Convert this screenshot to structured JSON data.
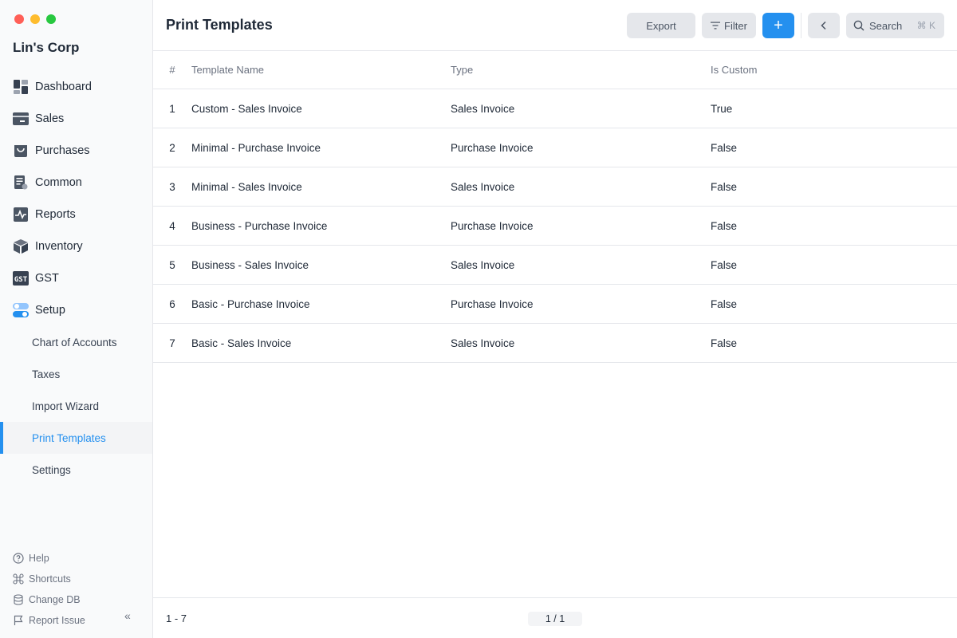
{
  "window": {
    "controls": [
      "close",
      "minimize",
      "maximize"
    ],
    "control_colors": [
      "#ff5f57",
      "#febc2e",
      "#28c840"
    ]
  },
  "sidebar": {
    "company": "Lin's Corp",
    "items": [
      {
        "label": "Dashboard",
        "icon": "dashboard-icon"
      },
      {
        "label": "Sales",
        "icon": "sales-icon"
      },
      {
        "label": "Purchases",
        "icon": "purchases-icon"
      },
      {
        "label": "Common",
        "icon": "common-icon"
      },
      {
        "label": "Reports",
        "icon": "reports-icon"
      },
      {
        "label": "Inventory",
        "icon": "inventory-icon"
      },
      {
        "label": "GST",
        "icon": "gst-icon"
      },
      {
        "label": "Setup",
        "icon": "setup-icon"
      }
    ],
    "setup_subitems": [
      {
        "label": "Chart of Accounts",
        "active": false
      },
      {
        "label": "Taxes",
        "active": false
      },
      {
        "label": "Import Wizard",
        "active": false
      },
      {
        "label": "Print Templates",
        "active": true
      },
      {
        "label": "Settings",
        "active": false
      }
    ],
    "footer": [
      {
        "label": "Help",
        "icon": "help-icon"
      },
      {
        "label": "Shortcuts",
        "icon": "command-icon"
      },
      {
        "label": "Change DB",
        "icon": "database-icon"
      },
      {
        "label": "Report Issue",
        "icon": "flag-icon"
      }
    ],
    "collapse_label": "«"
  },
  "header": {
    "title": "Print Templates",
    "export_label": "Export",
    "filter_label": "Filter",
    "add_label": "+",
    "back_label": "‹",
    "search_label": "Search",
    "search_shortcut": "⌘ K"
  },
  "table": {
    "columns": [
      "#",
      "Template Name",
      "Type",
      "Is Custom"
    ],
    "rows": [
      [
        "1",
        "Custom - Sales Invoice",
        "Sales Invoice",
        "True"
      ],
      [
        "2",
        "Minimal - Purchase Invoice",
        "Purchase Invoice",
        "False"
      ],
      [
        "3",
        "Minimal - Sales Invoice",
        "Sales Invoice",
        "False"
      ],
      [
        "4",
        "Business - Purchase Invoice",
        "Purchase Invoice",
        "False"
      ],
      [
        "5",
        "Business - Sales Invoice",
        "Sales Invoice",
        "False"
      ],
      [
        "6",
        "Basic - Purchase Invoice",
        "Purchase Invoice",
        "False"
      ],
      [
        "7",
        "Basic - Sales Invoice",
        "Sales Invoice",
        "False"
      ]
    ]
  },
  "footer": {
    "count": "1 - 7",
    "page": "1 / 1"
  },
  "colors": {
    "accent": "#2490ef",
    "icon": "#374151",
    "setup_icon": "#60a5fa"
  }
}
